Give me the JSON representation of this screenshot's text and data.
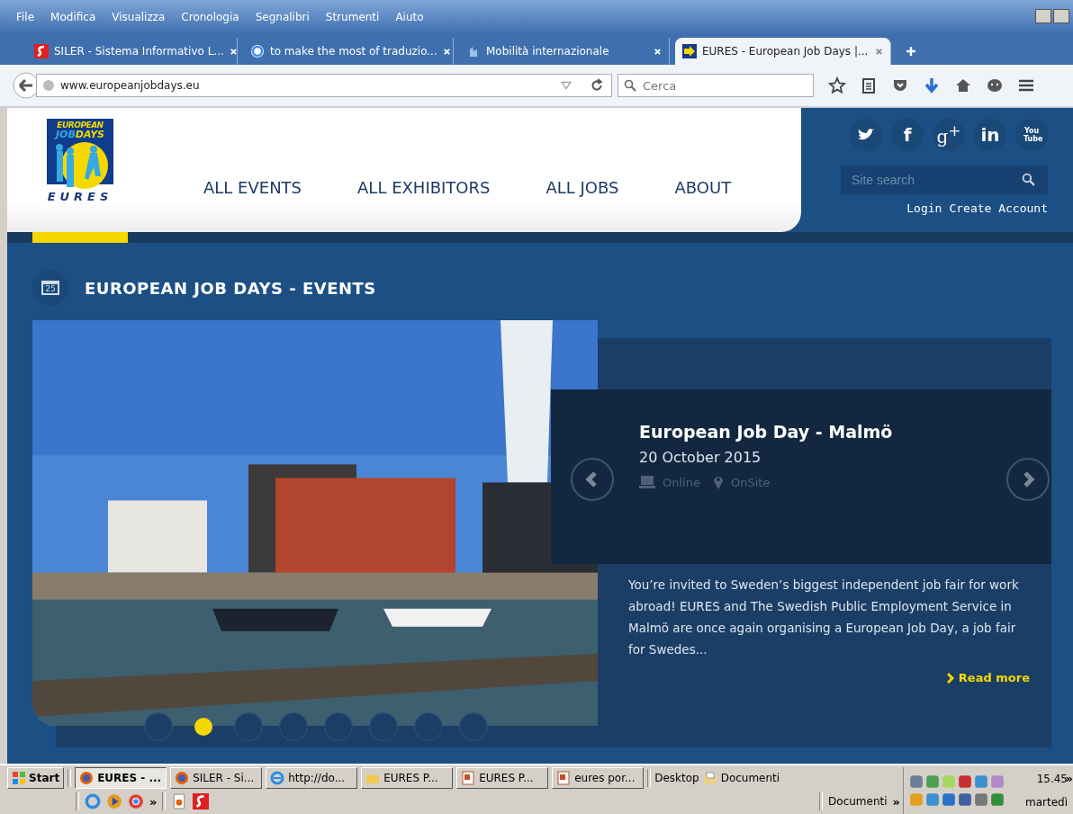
{
  "menu_bar": [
    "File",
    "Modifica",
    "Visualizza",
    "Cronologia",
    "Segnalibri",
    "Strumenti",
    "Aiuto"
  ],
  "tabs": [
    {
      "label": "SILER - Sistema Informativo L...",
      "kind": "siler",
      "selected": false
    },
    {
      "label": "to make the most of traduzio...",
      "kind": "google",
      "selected": false
    },
    {
      "label": "Mobilità internazionale",
      "kind": "hand",
      "selected": false
    },
    {
      "label": "EURES - European Job Days |...",
      "kind": "eures",
      "selected": true
    }
  ],
  "address_bar": {
    "url": "www.europeanjobdays.eu"
  },
  "browser_search": {
    "placeholder": "Cerca"
  },
  "logo": {
    "top": "EUROPEAN",
    "job": "JOB",
    "days": "DAYS",
    "bottom": "EURES"
  },
  "nav": [
    "ALL EVENTS",
    "ALL EXHIBITORS",
    "ALL JOBS",
    "ABOUT"
  ],
  "social": [
    {
      "kind": "twitter"
    },
    {
      "kind": "facebook",
      "glyph": "f"
    },
    {
      "kind": "gplus",
      "glyph": "g$^{+}$"
    },
    {
      "kind": "linkedin",
      "glyph": "in"
    },
    {
      "kind": "youtube",
      "glyph": "You Tube"
    }
  ],
  "site_search": {
    "placeholder": "Site search"
  },
  "account_links": [
    "Login",
    "Create Account"
  ],
  "section": {
    "day": "25",
    "title": "EUROPEAN JOB DAYS - EVENTS"
  },
  "event": {
    "title": "European Job Day - Malmö",
    "date": "20 October 2015",
    "tags": [
      {
        "kind": "online",
        "label": "Online"
      },
      {
        "kind": "onsite",
        "label": "OnSite"
      }
    ],
    "description": "You’re invited to Sweden’s biggest independent job fair for work abroad! EURES and The Swedish Public Employment Service in Malmö are once again organising a European Job Day, a job fair for Swedes...",
    "read_more": "Read more"
  },
  "slides": [
    {
      "selected": false
    },
    {
      "selected": true
    },
    {
      "selected": false
    },
    {
      "selected": false
    },
    {
      "selected": false
    },
    {
      "selected": false
    },
    {
      "selected": false
    },
    {
      "selected": false
    }
  ],
  "taskbar": {
    "start": "Start",
    "buttons": [
      {
        "label": "EURES - ...",
        "kind": "firefox",
        "selected": true
      },
      {
        "label": "SILER - Si...",
        "kind": "firefox",
        "selected": false
      },
      {
        "label": "http://do...",
        "kind": "ie",
        "selected": false
      },
      {
        "label": "EURES P...",
        "kind": "folder",
        "selected": false
      },
      {
        "label": "EURES P...",
        "kind": "ppt",
        "selected": false
      },
      {
        "label": "eures por...",
        "kind": "ppt",
        "selected": false
      }
    ],
    "chevrons": [
      "»",
      "»",
      "»"
    ],
    "desktop": "Desktop",
    "documents": "Documenti",
    "documents_toolbar": "Documenti",
    "time": "15.45",
    "day": "martedì"
  }
}
